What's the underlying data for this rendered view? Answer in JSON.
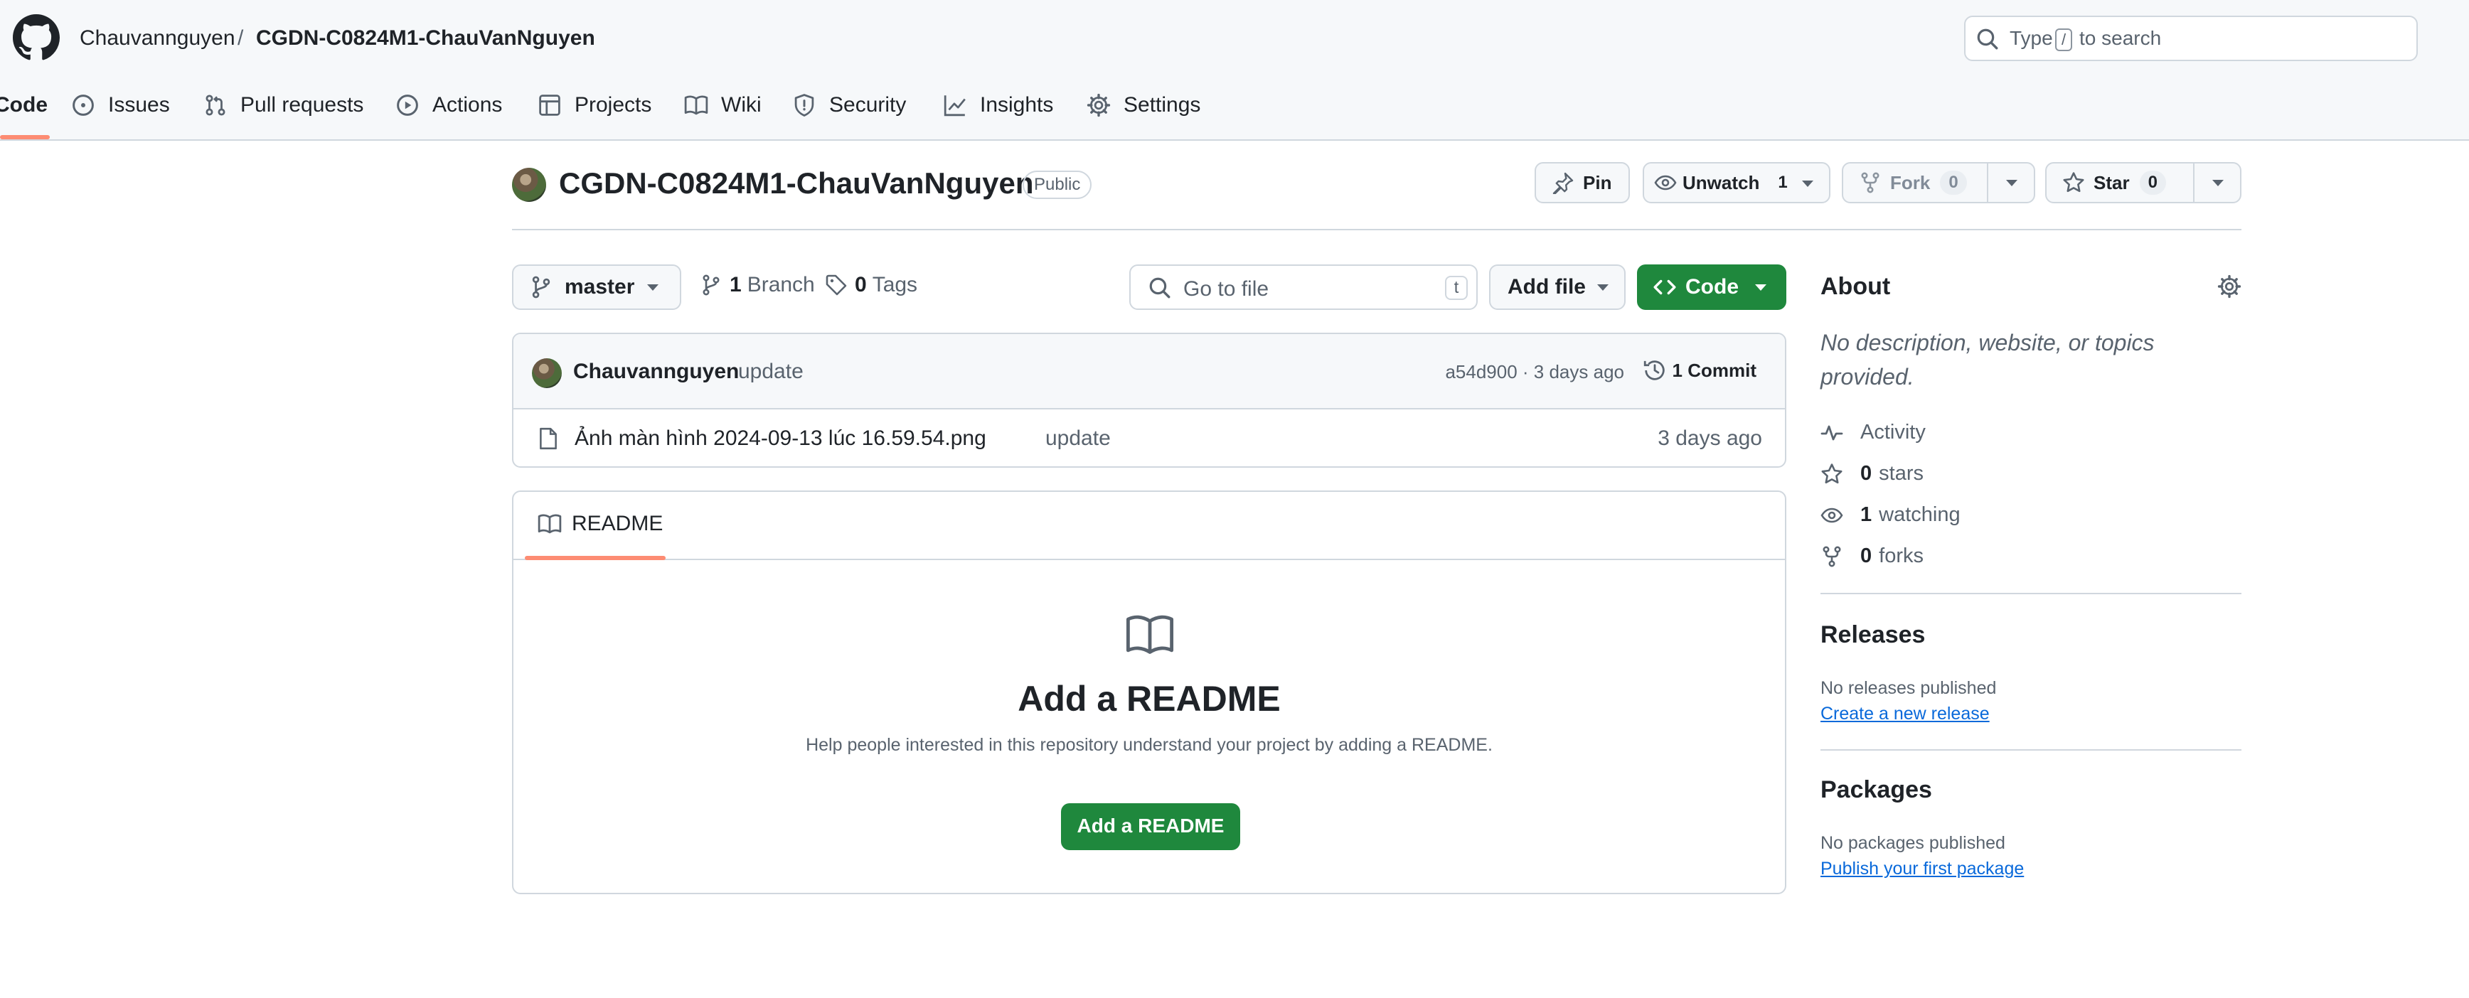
{
  "header": {
    "owner": "Chauvannguyen",
    "separator": "/",
    "repo": "CGDN-C0824M1-ChauVanNguyen",
    "search": {
      "before": "Type",
      "key": "/",
      "after": "to search"
    }
  },
  "tabs": [
    {
      "label": "Code",
      "icon": "code-icon",
      "selected": true
    },
    {
      "label": "Issues",
      "icon": "issue-icon"
    },
    {
      "label": "Pull requests",
      "icon": "pull-request-icon"
    },
    {
      "label": "Actions",
      "icon": "play-icon"
    },
    {
      "label": "Projects",
      "icon": "table-icon"
    },
    {
      "label": "Wiki",
      "icon": "book-icon"
    },
    {
      "label": "Security",
      "icon": "shield-icon"
    },
    {
      "label": "Insights",
      "icon": "graph-icon"
    },
    {
      "label": "Settings",
      "icon": "gear-icon"
    }
  ],
  "repo_header": {
    "title": "CGDN-C0824M1-ChauVanNguyen",
    "visibility": "Public",
    "pin": "Pin",
    "unwatch": "Unwatch",
    "watch_count": "1",
    "fork": "Fork",
    "fork_count": "0",
    "star": "Star",
    "star_count": "0"
  },
  "file_nav": {
    "branch": "master",
    "branches_count": "1",
    "branches_label": "Branch",
    "tags_count": "0",
    "tags_label": "Tags",
    "go_to_file": "Go to file",
    "go_to_file_key": "t",
    "add_file": "Add file",
    "code": "Code"
  },
  "latest_commit": {
    "author": "Chauvannguyen",
    "message": "update",
    "meta": "a54d900 · 3 days ago",
    "commits": "1 Commit"
  },
  "files": [
    {
      "name": "Ảnh màn hình 2024-09-13 lúc 16.59.54.png",
      "message": "update",
      "date": "3 days ago",
      "icon": "file-icon"
    }
  ],
  "readme": {
    "tab": "README",
    "title": "Add a README",
    "description": "Help people interested in this repository understand your project by adding a README.",
    "button": "Add a README"
  },
  "about": {
    "heading": "About",
    "description": "No description, website, or topics provided.",
    "activity": "Activity",
    "stars_count": "0",
    "stars_label": "stars",
    "watching_count": "1",
    "watching_label": "watching",
    "forks_count": "0",
    "forks_label": "forks"
  },
  "releases": {
    "heading": "Releases",
    "empty": "No releases published",
    "link": "Create a new release"
  },
  "packages": {
    "heading": "Packages",
    "empty": "No packages published",
    "link": "Publish your first package"
  },
  "colors": {
    "accent_green": "#1f883d",
    "tab_underline": "#fd8c73",
    "link": "#0969da",
    "muted": "#59636e",
    "border": "#d0d7de"
  }
}
